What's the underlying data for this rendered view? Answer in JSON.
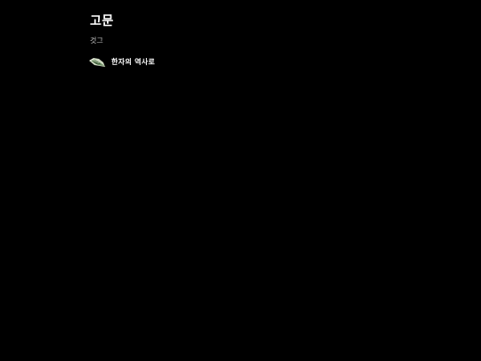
{
  "page": {
    "title": "고문",
    "subtitle": "것그"
  },
  "list": {
    "items": [
      {
        "label": "한자의 역사로",
        "icon": "fan-thumbnail-icon"
      }
    ]
  },
  "colors": {
    "background": "#000000",
    "text": "#ffffff",
    "subtext": "#c8c8c8"
  }
}
